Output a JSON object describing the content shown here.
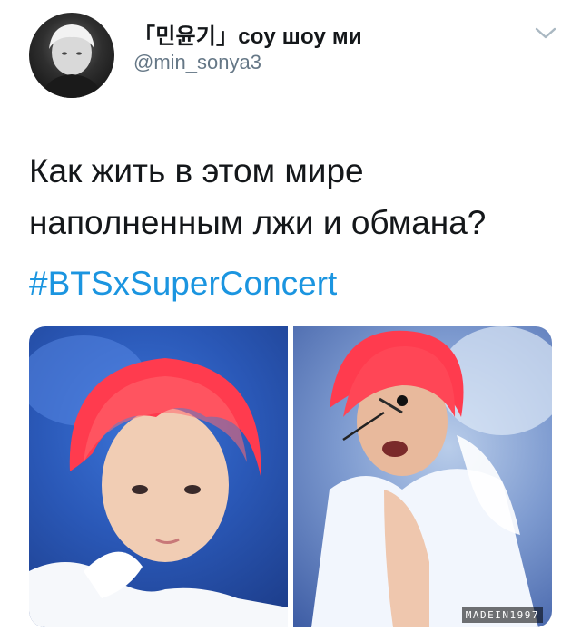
{
  "author": {
    "display_name": "「민윤기」соу шоу ми",
    "handle": "@min_sonya3",
    "avatar_icon": "avatar-photo"
  },
  "menu": {
    "icon": "chevron-down-icon",
    "color": "#aab8c2"
  },
  "tweet": {
    "text_line_1": "Как жить в этом мире",
    "text_line_2": "наполненным лжи и обмана?",
    "hashtag": "#BTSxSuperConcert",
    "hashtag_color": "#1b95e0"
  },
  "media": {
    "photo_count": 2,
    "watermark": "MADEIN1997"
  }
}
